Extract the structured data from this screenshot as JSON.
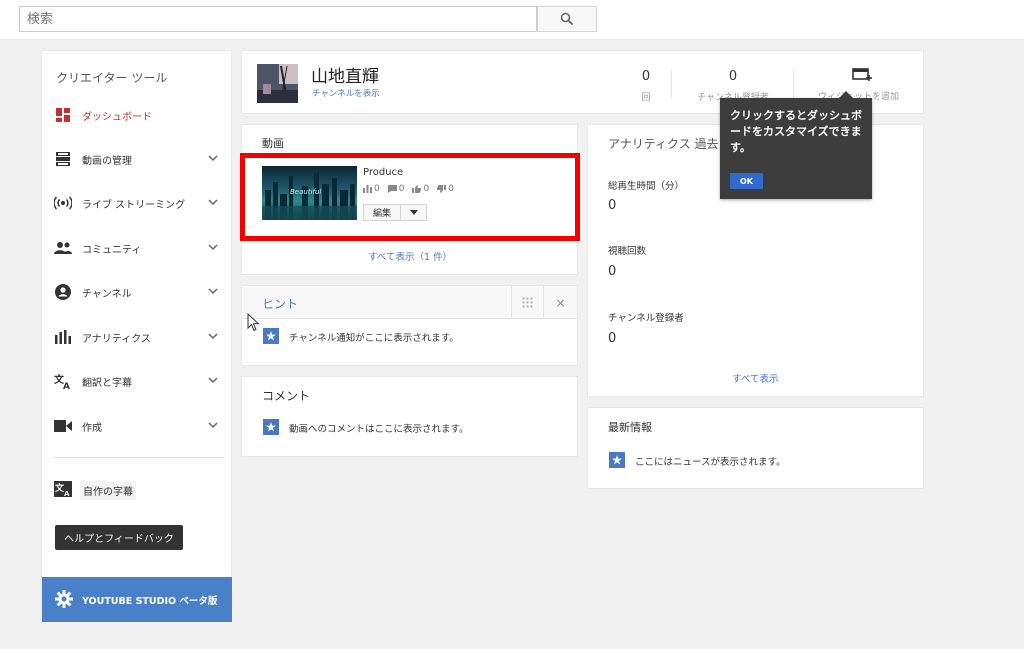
{
  "search": {
    "placeholder": "検索",
    "button_icon": "search-icon"
  },
  "sidebar": {
    "title": "クリエイター ツール",
    "items": [
      {
        "label": "ダッシュボード",
        "icon": "dashboard-icon",
        "active": true
      },
      {
        "label": "動画の管理",
        "icon": "video-manager-icon"
      },
      {
        "label": "ライブ ストリーミング",
        "icon": "live-streaming-icon"
      },
      {
        "label": "コミュニティ",
        "icon": "community-icon"
      },
      {
        "label": "チャンネル",
        "icon": "channel-icon"
      },
      {
        "label": "アナリティクス",
        "icon": "analytics-icon"
      },
      {
        "label": "翻訳と字幕",
        "icon": "translate-icon"
      },
      {
        "label": "作成",
        "icon": "create-icon"
      }
    ],
    "subtitles_label": "自作の字幕",
    "help_label": "ヘルプとフィードバック",
    "studio_label": "YOUTUBE STUDIO ベータ版"
  },
  "channel": {
    "name": "山地直輝",
    "link": "チャンネルを表示",
    "stats": [
      {
        "value": "0",
        "caption": "回"
      },
      {
        "value": "0",
        "caption": "チャンネル登録者"
      }
    ],
    "add_widget": "ウィジェットを追加"
  },
  "videos": {
    "title": "動画",
    "video": {
      "name": "Produce",
      "thumb_text": "Beautiful",
      "views": "0",
      "comments": "0",
      "likes": "0",
      "dislikes": "0",
      "edit_label": "編集"
    },
    "show_all": "すべて表示（1 件）"
  },
  "hint": {
    "title": "ヒント",
    "close": "×",
    "message": "チャンネル通知がここに表示されます。"
  },
  "comments": {
    "title": "コメント",
    "message": "動画へのコメントはここに表示されます。"
  },
  "analytics": {
    "title": "アナリティクス  過去",
    "metrics": [
      {
        "label": "総再生時間（分）",
        "value": "0"
      },
      {
        "label": "視聴回数",
        "value": "0"
      },
      {
        "label": "チャンネル登録者",
        "value": "0"
      }
    ],
    "show_all": "すべて表示"
  },
  "news": {
    "title": "最新情報",
    "message": "ここにはニュースが表示されます。"
  },
  "tooltip": {
    "text": "クリックするとダッシュボードをカスタマイズできます。",
    "ok": "OK"
  },
  "colors": {
    "accent_blue": "#4a79c3",
    "highlight_red": "#f50000",
    "active_red": "#c4302b",
    "studio_blue": "#4a80c8"
  }
}
